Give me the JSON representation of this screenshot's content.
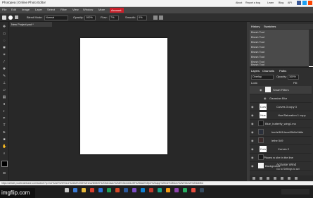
{
  "app": {
    "title": "Photopea | Online Photo Editor",
    "header_links": [
      "About",
      "Report a bug",
      "Learn",
      "Blog",
      "API"
    ]
  },
  "menu": {
    "items": [
      "File",
      "Edit",
      "Image",
      "Layer",
      "Select",
      "Filter",
      "View",
      "Window",
      "More"
    ],
    "account": "Account"
  },
  "options": {
    "blend_label": "Blend Mode:",
    "blend_value": "Normal",
    "opacity_label": "Opacity:",
    "opacity_value": "100%",
    "flow_label": "Flow:",
    "flow_value": "7%",
    "smooth_label": "Smooth:",
    "smooth_value": "0%"
  },
  "document": {
    "tab_label": "New Project.psd *"
  },
  "history": {
    "tabs": [
      "History",
      "Swatches"
    ],
    "items": [
      "Brush Tool",
      "Brush Tool",
      "Brush Tool",
      "Brush Tool",
      "Brush Tool",
      "Brush Tool",
      "Brush Tool",
      "Brush Tool"
    ]
  },
  "layers": {
    "tabs": [
      "Layers",
      "Channels",
      "Paths"
    ],
    "blend": "Overlay",
    "opacity_label": "Opacity:",
    "opacity_value": "100%",
    "lock_label": "Lock:",
    "fill_label": "Fill:",
    "rows": [
      {
        "name": "Smart Filters",
        "thumb": "white"
      },
      {
        "name": "Gaussian Blur",
        "thumb": "none"
      },
      {
        "name": "Curves 3 copy 3",
        "thumb": "curve"
      },
      {
        "name": "Hue/Saturation 1 copy",
        "thumb": "hue"
      },
      {
        "name": "Blue_butterfly_wing1.mo",
        "thumb": "dark"
      },
      {
        "name": "fee4e3814ece89b0e0b6e",
        "thumb": "dark"
      },
      {
        "name": "lethe 549",
        "thumb": "dark"
      },
      {
        "name": "Curves 2",
        "thumb": "curve"
      },
      {
        "name": "Places w she in the line",
        "thumb": "dark"
      },
      {
        "name": "Background",
        "thumb": "white"
      }
    ],
    "curve_thumb_label": "Curv",
    "hue_thumb_label": "Hue"
  },
  "statusbar": {
    "url": "https://article.yourbrushbase.com/search?q=0c1%2a0%2b%3c1%2d6d%2f33%2f1ea26b0bf0%2f3fd10adc%2fd6%3ecfd31c59%2f8da3%3fp3%2fcapp%2fb4e%2fb1ec%2fzi%3cfvh%2f4dbfbd"
  },
  "activate": {
    "line1": "Activate Wind",
    "line2": "Go to Settings to act"
  },
  "watermark": "imgflip.com"
}
